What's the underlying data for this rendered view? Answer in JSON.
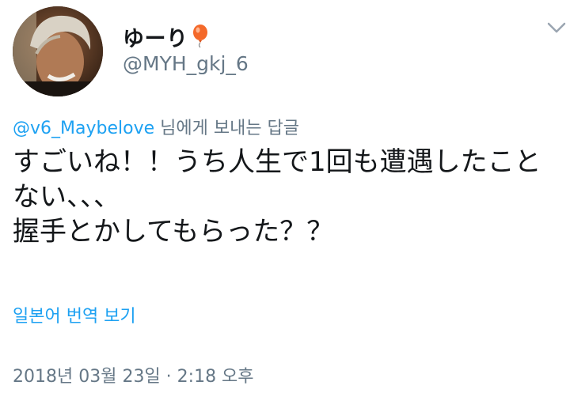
{
  "user": {
    "display_name": "ゆーり",
    "handle": "@MYH_gkj_6",
    "emoji_icon": "balloon-icon"
  },
  "reply": {
    "mention": "@v6_Maybelove",
    "suffix": " 님에게 보내는 답글"
  },
  "tweet": {
    "text": "すごいね！！うち人生で1回も遭遇したことない、、、\n握手とかしてもらった？？"
  },
  "translate_link": "일본어 번역 보기",
  "timestamp": "2018년 03월 23일 · 2:18 오후",
  "colors": {
    "link": "#1da1f2",
    "secondary": "#657786",
    "text": "#14171a",
    "balloon": "#f4692a"
  }
}
